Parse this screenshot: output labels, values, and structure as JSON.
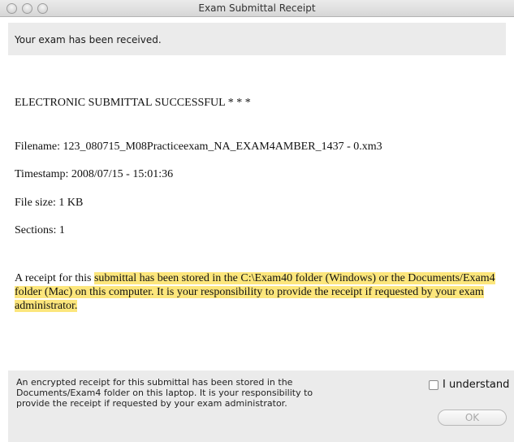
{
  "window": {
    "title": "Exam Submittal Receipt"
  },
  "banner": {
    "text": "Your exam has been received."
  },
  "content": {
    "status": "ELECTRONIC SUBMITTAL SUCCESSFUL * * *",
    "filename": "Filename: 123_080715_M08Practiceexam_NA_EXAM4AMBER_1437 - 0.xm3",
    "timestamp": "Timestamp: 2008/07/15 - 15:01:36",
    "filesize": "File size: 1 KB",
    "sections": "Sections: 1",
    "receipt_plain": "A receipt for this ",
    "receipt_highlighted": "submittal has been stored in the C:\\Exam40 folder (Windows) or the Documents/Exam4 folder (Mac) on this computer. It is your responsibility to provide the receipt if requested by your exam administrator."
  },
  "footer": {
    "notice": "An encrypted receipt for this submittal has been stored in the Documents/Exam4 folder on this laptop.  It is your responsibility to provide the receipt if requested by your exam administrator.",
    "checkbox_label": "I understand",
    "ok_label": "OK"
  },
  "colors": {
    "highlight": "#fce67c",
    "panel": "#ebebeb"
  }
}
